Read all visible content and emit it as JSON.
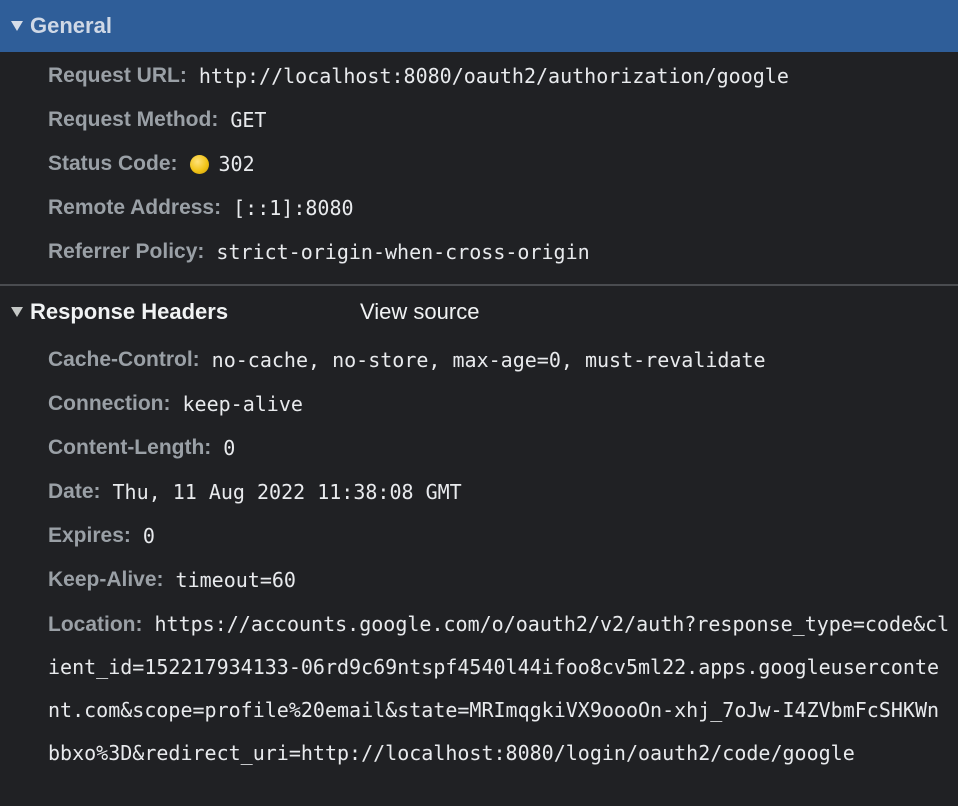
{
  "general": {
    "title": "General",
    "rows": {
      "request_url": {
        "key": "Request URL:",
        "value": "http://localhost:8080/oauth2/authorization/google"
      },
      "request_method": {
        "key": "Request Method:",
        "value": "GET"
      },
      "status_code": {
        "key": "Status Code:",
        "value": "302",
        "status_color": "#f2c418"
      },
      "remote_address": {
        "key": "Remote Address:",
        "value": "[::1]:8080"
      },
      "referrer_policy": {
        "key": "Referrer Policy:",
        "value": "strict-origin-when-cross-origin"
      }
    }
  },
  "response_headers": {
    "title": "Response Headers",
    "view_source": "View source",
    "rows": {
      "cache_control": {
        "key": "Cache-Control:",
        "value": "no-cache, no-store, max-age=0, must-revalidate"
      },
      "connection": {
        "key": "Connection:",
        "value": "keep-alive"
      },
      "content_length": {
        "key": "Content-Length:",
        "value": "0"
      },
      "date": {
        "key": "Date:",
        "value": "Thu, 11 Aug 2022 11:38:08 GMT"
      },
      "expires": {
        "key": "Expires:",
        "value": "0"
      },
      "keep_alive": {
        "key": "Keep-Alive:",
        "value": "timeout=60"
      },
      "location": {
        "key": "Location:",
        "value": "https://accounts.google.com/o/oauth2/v2/auth?response_type=code&client_id=152217934133-06rd9c69ntspf4540l44ifoo8cv5ml22.apps.googleusercontent.com&scope=profile%20email&state=MRImqgkiVX9oooOn-xhj_7oJw-I4ZVbmFcSHKWnbbxo%3D&redirect_uri=http://localhost:8080/login/oauth2/code/google"
      }
    }
  },
  "icons": {
    "collapse": "triangle-down-icon",
    "status": "status-dot-icon"
  },
  "colors": {
    "selected_header_bg": "#2f5e99",
    "background": "#202124",
    "key_text": "#9aa0a6",
    "value_text": "#e8eaed"
  }
}
